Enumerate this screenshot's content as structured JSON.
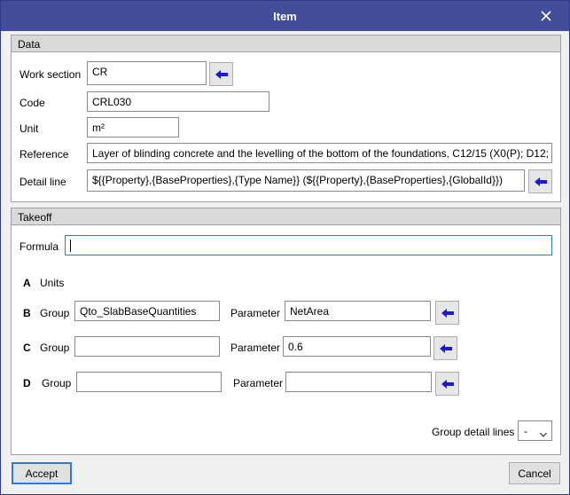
{
  "window": {
    "title": "Item",
    "close_icon": "close-icon"
  },
  "data_section": {
    "header": "Data",
    "work_section": {
      "label": "Work section",
      "value": "CR"
    },
    "code": {
      "label": "Code",
      "value": "CRL030"
    },
    "unit": {
      "label": "Unit",
      "value": "m²"
    },
    "reference": {
      "label": "Reference",
      "value": "Layer of blinding concrete and the levelling of the bottom of the foundations,  C12/15 (X0(P); D12;"
    },
    "detail_line": {
      "label": "Detail line",
      "value": "${{Property},{BaseProperties},{Type Name}} (${{Property},{BaseProperties},{GlobalId}})"
    }
  },
  "takeoff_section": {
    "header": "Takeoff",
    "formula": {
      "label": "Formula",
      "value": ""
    },
    "row_a": {
      "letter": "A",
      "label": "Units"
    },
    "row_b": {
      "letter": "B",
      "group_label": "Group",
      "group_value": "Qto_SlabBaseQuantities",
      "param_label": "Parameter",
      "param_value": "NetArea"
    },
    "row_c": {
      "letter": "C",
      "group_label": "Group",
      "group_value": "",
      "param_label": "Parameter",
      "param_value": "0.6"
    },
    "row_d": {
      "letter": "D",
      "group_label": "Group",
      "group_value": "",
      "param_label": "Parameter",
      "param_value": ""
    },
    "group_detail_lines": {
      "label": "Group detail lines",
      "selected": "-"
    }
  },
  "buttons": {
    "accept": "Accept",
    "cancel": "Cancel"
  },
  "colors": {
    "titlebar": "#434d9a",
    "arrow": "#1a1ad6",
    "focus": "#3078d6"
  }
}
